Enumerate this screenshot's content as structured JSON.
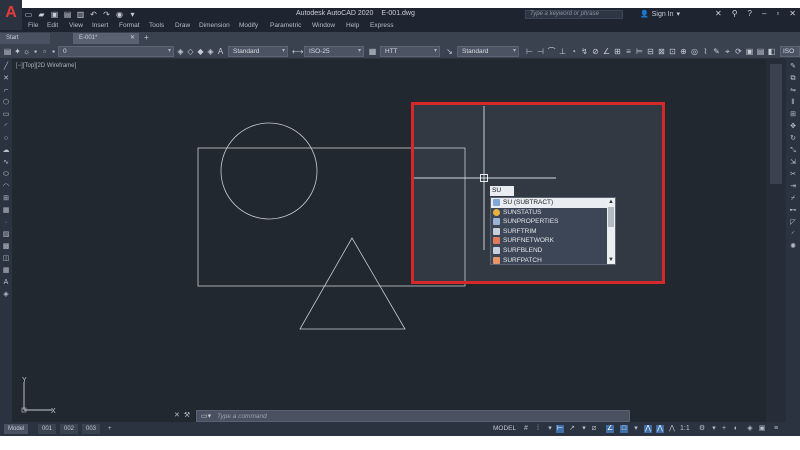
{
  "app": {
    "logo_letter": "A",
    "title": "Autodesk AutoCAD 2020",
    "filename": "E-001.dwg",
    "search_placeholder": "Type a keyword or phrase",
    "sign_in": "Sign In"
  },
  "menu": [
    "File",
    "Edit",
    "View",
    "Insert",
    "Format",
    "Tools",
    "Draw",
    "Dimension",
    "Modify",
    "Parametric",
    "Window",
    "Help",
    "Express"
  ],
  "tabs": {
    "start": "Start",
    "file": "E-001*",
    "add": "+"
  },
  "toolbar": {
    "layer_value": "0",
    "text_style": "Standard",
    "dim_style": "ISO-25",
    "table_style": "HTT",
    "multileader_style": "Standard",
    "iso_label": "ISO"
  },
  "viewport": {
    "label": "[−][Top][2D Wireframe]"
  },
  "command": {
    "typed": "SU",
    "placeholder": "Type a command",
    "suggestions": [
      {
        "label": "SU (SUBTRACT)",
        "icon_color": "#7fa7d8"
      },
      {
        "label": "SUNSTATUS",
        "icon_color": "#e8b23a"
      },
      {
        "label": "SUNPROPERTIES",
        "icon_color": "#9ab4d6"
      },
      {
        "label": "SURFTRIM",
        "icon_color": "#c8d0dc"
      },
      {
        "label": "SURFNETWORK",
        "icon_color": "#e07a5a"
      },
      {
        "label": "SURFBLEND",
        "icon_color": "#c8d0dc"
      },
      {
        "label": "SURFPATCH",
        "icon_color": "#e8956a"
      }
    ]
  },
  "ucs": {
    "x": "X",
    "y": "Y"
  },
  "status": {
    "layouts": [
      "Model",
      "001",
      "002",
      "003"
    ],
    "layout_add": "+",
    "model_label": "MODEL"
  },
  "colors": {
    "canvas": "#212830",
    "highlight": "#d62828",
    "geometry": "#c8ccd2"
  }
}
